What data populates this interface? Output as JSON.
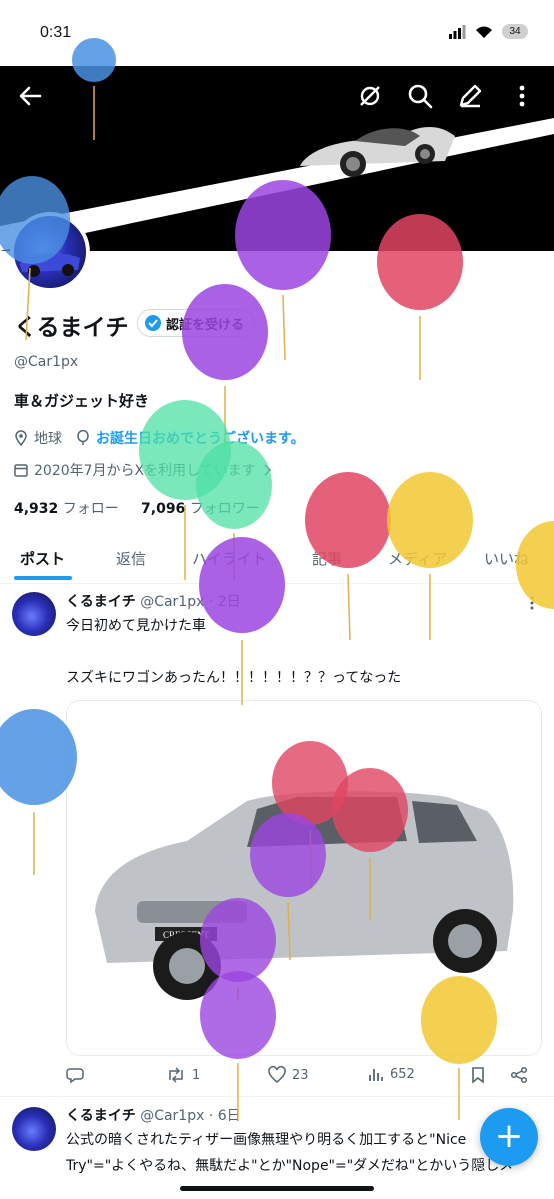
{
  "status": {
    "time": "0:31",
    "battery": "34"
  },
  "profile": {
    "name": "くるまイチ",
    "verify_label": "認証を受ける",
    "handle": "@Car1px",
    "bio": "車＆ガジェット好き",
    "location": "地球",
    "birthday": "お誕生日おめでとうございます。",
    "joined": "2020年7月からXを利用しています",
    "following_count": "4,932",
    "following_label": "フォロー",
    "followers_count": "7,096",
    "followers_label": "フォロワー"
  },
  "tabs": [
    {
      "label": "ポスト",
      "active": true
    },
    {
      "label": "返信"
    },
    {
      "label": "ハイライト"
    },
    {
      "label": "記事"
    },
    {
      "label": "メディア"
    },
    {
      "label": "いいね"
    }
  ],
  "posts": [
    {
      "name": "くるまイチ",
      "handle_time": "@Car1px · 2日",
      "line1": "今日初めて見かけた車",
      "line2": "スズキにワゴンあったん！！！！！！？？ってなった",
      "media_label": "CRESCENT",
      "reposts": "1",
      "likes": "23",
      "views": "652"
    },
    {
      "name": "くるまイチ",
      "handle_time": "@Car1px · 6日",
      "line1": "公式の暗くされたティザー画像無理やり明るく加工すると\"Nice",
      "line2": "Try\"=\"よくやるね、無駄だよ\"とか\"Nope\"=\"ダメだね\"とかいう隠しメ"
    }
  ],
  "colors": {
    "accent": "#1d9bf0",
    "text": "#0f1419",
    "muted": "#536471"
  },
  "icons": [
    "back-arrow-icon",
    "sync-off-icon",
    "search-icon",
    "edit-icon",
    "more-vertical-icon",
    "verified-badge-icon",
    "location-icon",
    "balloon-icon",
    "calendar-icon",
    "chevron-right-icon",
    "reply-icon",
    "repost-icon",
    "like-icon",
    "views-icon",
    "bookmark-icon",
    "share-icon",
    "compose-plus-icon"
  ]
}
